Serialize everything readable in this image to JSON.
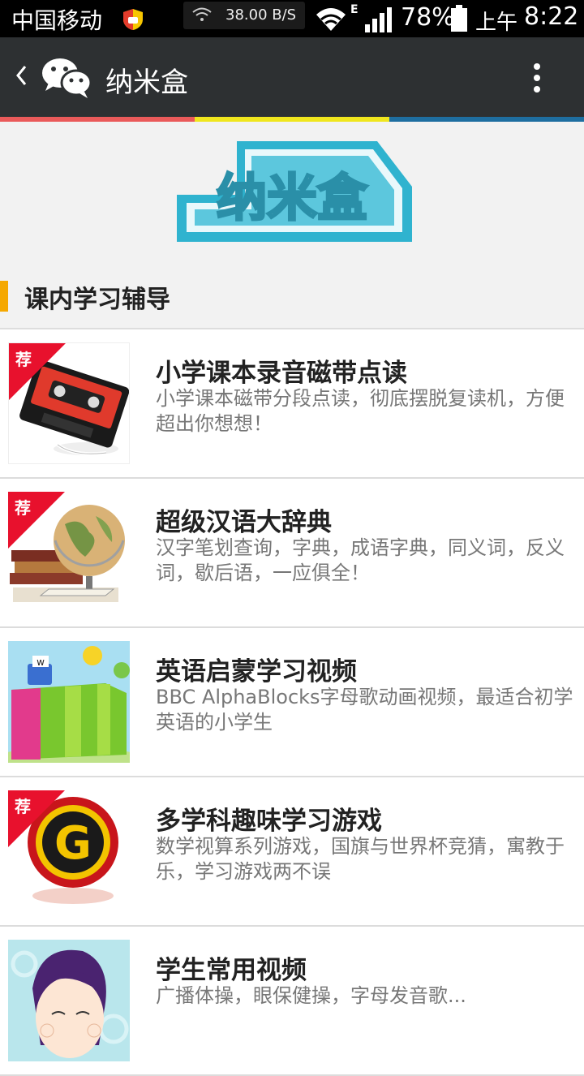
{
  "status_bar": {
    "carrier": "中国移动",
    "net_speed": "38.00 B/S",
    "network_type": "E",
    "battery": "78%",
    "ampm": "上午",
    "time": "8:22"
  },
  "header": {
    "title": "纳米盒"
  },
  "banner": {
    "logo_text": "纳米盒"
  },
  "section": {
    "title": "课内学习辅导"
  },
  "items": [
    {
      "title": "小学课本录音磁带点读",
      "desc": "小学课本磁带分段点读，彻底摆脱复读机，方便超出你想想！",
      "badge": "荐",
      "thumb_icon": "cassette-tape-icon"
    },
    {
      "title": "超级汉语大辞典",
      "desc": "汉字笔划查询，字典，成语字典，同义词，反义词，歇后语，一应俱全！",
      "badge": "荐",
      "thumb_icon": "globe-books-icon"
    },
    {
      "title": "英语启蒙学习视频",
      "desc": "BBC AlphaBlocks字母歌动画视频，最适合初学英语的小学生",
      "badge": "",
      "thumb_icon": "alphablocks-icon"
    },
    {
      "title": "多学科趣味学习游戏",
      "desc": "数学视算系列游戏，国旗与世界杯竞猜，寓教于乐，学习游戏两不误",
      "badge": "荐",
      "thumb_icon": "g-game-icon"
    },
    {
      "title": "学生常用视频",
      "desc": "广播体操，眼保健操，字母发音歌...",
      "badge": "",
      "thumb_icon": "student-cartoon-icon"
    }
  ],
  "colors": {
    "accent_red": "#ea5a5a",
    "accent_yellow": "#f0e61e",
    "accent_blue": "#1e6ea0",
    "section_marker": "#f5a800",
    "titlebar_bg": "#2d3032"
  }
}
